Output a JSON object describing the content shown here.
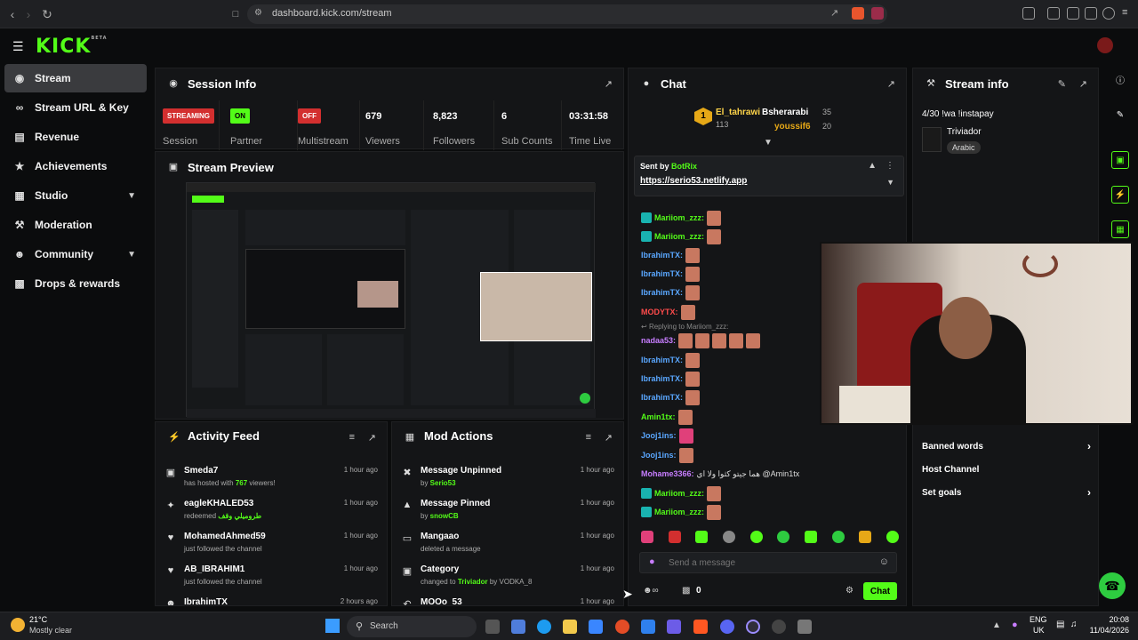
{
  "browser": {
    "url": "dashboard.kick.com/stream"
  },
  "app": {
    "logo": "KICK",
    "logo_sup": "BETA"
  },
  "sidebar": {
    "items": [
      {
        "label": "Stream"
      },
      {
        "label": "Stream URL & Key"
      },
      {
        "label": "Revenue"
      },
      {
        "label": "Achievements"
      },
      {
        "label": "Studio"
      },
      {
        "label": "Moderation"
      },
      {
        "label": "Community"
      },
      {
        "label": "Drops & rewards"
      }
    ]
  },
  "session": {
    "title": "Session Info",
    "stats": [
      {
        "badge": "STREAMING",
        "label": "Session"
      },
      {
        "badge": "ON",
        "label": "Partner"
      },
      {
        "badge": "OFF",
        "label": "Multistream"
      },
      {
        "value": "679",
        "label": "Viewers"
      },
      {
        "value": "8,823",
        "label": "Followers"
      },
      {
        "value": "6",
        "label": "Sub Counts"
      },
      {
        "value": "03:31:58",
        "label": "Time Live"
      }
    ]
  },
  "preview": {
    "title": "Stream Preview"
  },
  "activity": {
    "title": "Activity Feed",
    "items": [
      {
        "name": "Smeda7",
        "pre": "has hosted with ",
        "hl": "767",
        "post": " viewers!",
        "time": "1 hour ago"
      },
      {
        "name": "eagleKHALED53",
        "pre": "redeemed ",
        "hl": "طروميلي وقف",
        "post": "",
        "time": "1 hour ago"
      },
      {
        "name": "MohamedAhmed59",
        "pre": "just followed the channel",
        "hl": "",
        "post": "",
        "time": "1 hour ago"
      },
      {
        "name": "AB_IBRAHIM1",
        "pre": "just followed the channel",
        "hl": "",
        "post": "",
        "time": "1 hour ago"
      },
      {
        "name": "IbrahimTX",
        "pre": "",
        "hl": "",
        "post": "",
        "time": "2 hours ago"
      }
    ]
  },
  "modactions": {
    "title": "Mod Actions",
    "items": [
      {
        "name": "Message Unpinned",
        "pre": "by ",
        "hl": "Serio53",
        "post": "",
        "time": "1 hour ago"
      },
      {
        "name": "Message Pinned",
        "pre": "by ",
        "hl": "snowCB",
        "post": "",
        "time": "1 hour ago"
      },
      {
        "name": "Mangaao",
        "pre": "deleted a message",
        "hl": "",
        "post": "",
        "time": "1 hour ago"
      },
      {
        "name": "Category",
        "pre": "changed to ",
        "hl": "Triviador",
        "post": " by VODKA_8",
        "time": "1 hour ago"
      },
      {
        "name": "MOOo_53",
        "pre": "",
        "hl": "",
        "post": "",
        "time": "1 hour ago"
      }
    ]
  },
  "chat": {
    "title": "Chat",
    "leaderboard": [
      {
        "rank": "1",
        "name": "El_tahrawi",
        "count": "113"
      },
      {
        "name": "Bsherarabi",
        "count": "35"
      },
      {
        "name": "youssif6",
        "count": "20"
      }
    ],
    "pinned": {
      "by_label": "Sent by",
      "by_user": "BotRix",
      "link": "https://serio53.netlify.app"
    },
    "messages": [
      {
        "user": "Mariiom_zzz:",
        "color": "#53fc18"
      },
      {
        "user": "Mariiom_zzz:",
        "color": "#53fc18"
      },
      {
        "user": "IbrahimTX:",
        "color": "#5aa7ff"
      },
      {
        "user": "IbrahimTX:",
        "color": "#5aa7ff"
      },
      {
        "user": "IbrahimTX:",
        "color": "#5aa7ff"
      },
      {
        "user": "MODYTX:",
        "color": "#ff4b4b"
      },
      {
        "user": "nadaa53:",
        "color": "#c77dff",
        "reply": "Replying to Mariiom_zzz:"
      },
      {
        "user": "IbrahimTX:",
        "color": "#5aa7ff"
      },
      {
        "user": "IbrahimTX:",
        "color": "#5aa7ff"
      },
      {
        "user": "IbrahimTX:",
        "color": "#5aa7ff"
      },
      {
        "user": "Amin1tx:",
        "color": "#53fc18"
      },
      {
        "user": "Jooj1ins:",
        "color": "#5aa7ff"
      },
      {
        "user": "Jooj1ins:",
        "color": "#5aa7ff"
      },
      {
        "user": "Mohame3366:",
        "color": "#c77dff",
        "text": "هما جيتو كثوا ولا اي @Amin1tx"
      },
      {
        "user": "Mariiom_zzz:",
        "color": "#53fc18"
      },
      {
        "user": "Mariiom_zzz:",
        "color": "#53fc18"
      }
    ],
    "input_placeholder": "Send a message",
    "viewers_count": "0",
    "send_label": "Chat"
  },
  "streaminfo": {
    "title": "Stream info",
    "stream_title": "4/30 !wa !instapay",
    "category": "Triviador",
    "language": "Arabic",
    "links": [
      "Banned words",
      "Host Channel",
      "Set goals"
    ]
  },
  "taskbar": {
    "weather_temp": "21°C",
    "weather_desc": "Mostly clear",
    "search": "Search",
    "lang1": "ENG",
    "lang2": "UK",
    "time": "20:08",
    "date": "11/04/2026"
  },
  "colors": {
    "accent": "#53fc18",
    "streaming": "#d32f2f",
    "bg": "#0b0c0d",
    "panel": "#141517"
  }
}
